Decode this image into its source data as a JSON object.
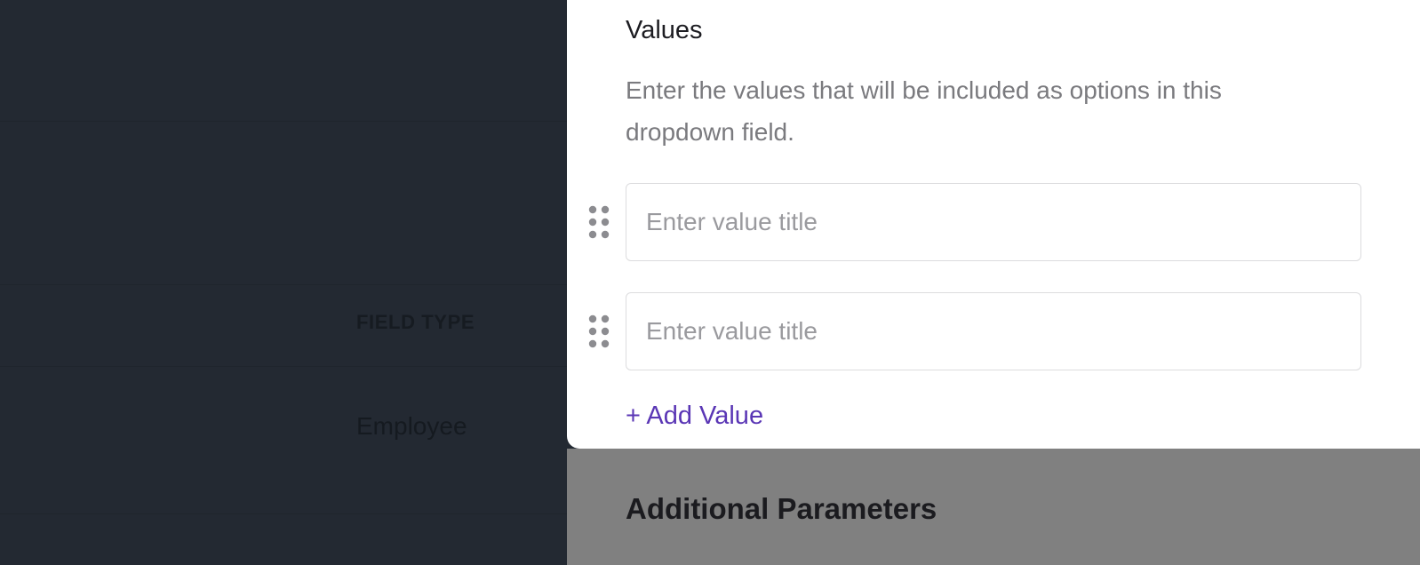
{
  "background": {
    "field_type_label": "FIELD TYPE",
    "field_type_value": "Employee"
  },
  "panel": {
    "title": "Values",
    "description": "Enter the values that will be included as options in this dropdown field.",
    "values": [
      {
        "value": "",
        "placeholder": "Enter value title",
        "handle_icon": "drag-handle-icon"
      },
      {
        "value": "",
        "placeholder": "Enter value title",
        "handle_icon": "drag-handle-icon"
      }
    ],
    "add_value_label": "+ Add Value",
    "accent_color": "#5a36b5"
  },
  "additional": {
    "heading": "Additional Parameters"
  }
}
